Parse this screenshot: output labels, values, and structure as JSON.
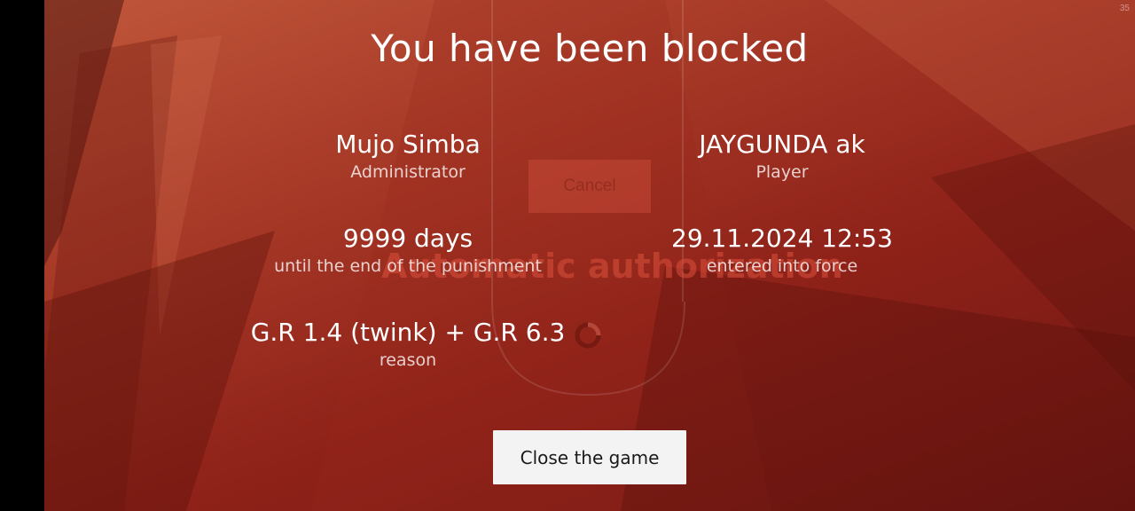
{
  "fps_counter": "35",
  "title": "You have been blocked",
  "background": {
    "ghost_cancel_label": "Cancel",
    "ghost_auth_text": "Automatic authorization"
  },
  "admin": {
    "name": "Mujo Simba",
    "role": "Administrator"
  },
  "player": {
    "name": "JAYGUNDA ak",
    "role": "Player"
  },
  "duration": {
    "value": "9999 days",
    "label": "until the end of the punishment"
  },
  "date": {
    "value": "29.11.2024 12:53",
    "label": "entered into force"
  },
  "reason": {
    "value": "G.R 1.4 (twink) + G.R 6.3",
    "label": "reason"
  },
  "close_button_label": "Close the game",
  "colors": {
    "background_red": "#a83a28",
    "button_bg": "#f3f3f3"
  }
}
